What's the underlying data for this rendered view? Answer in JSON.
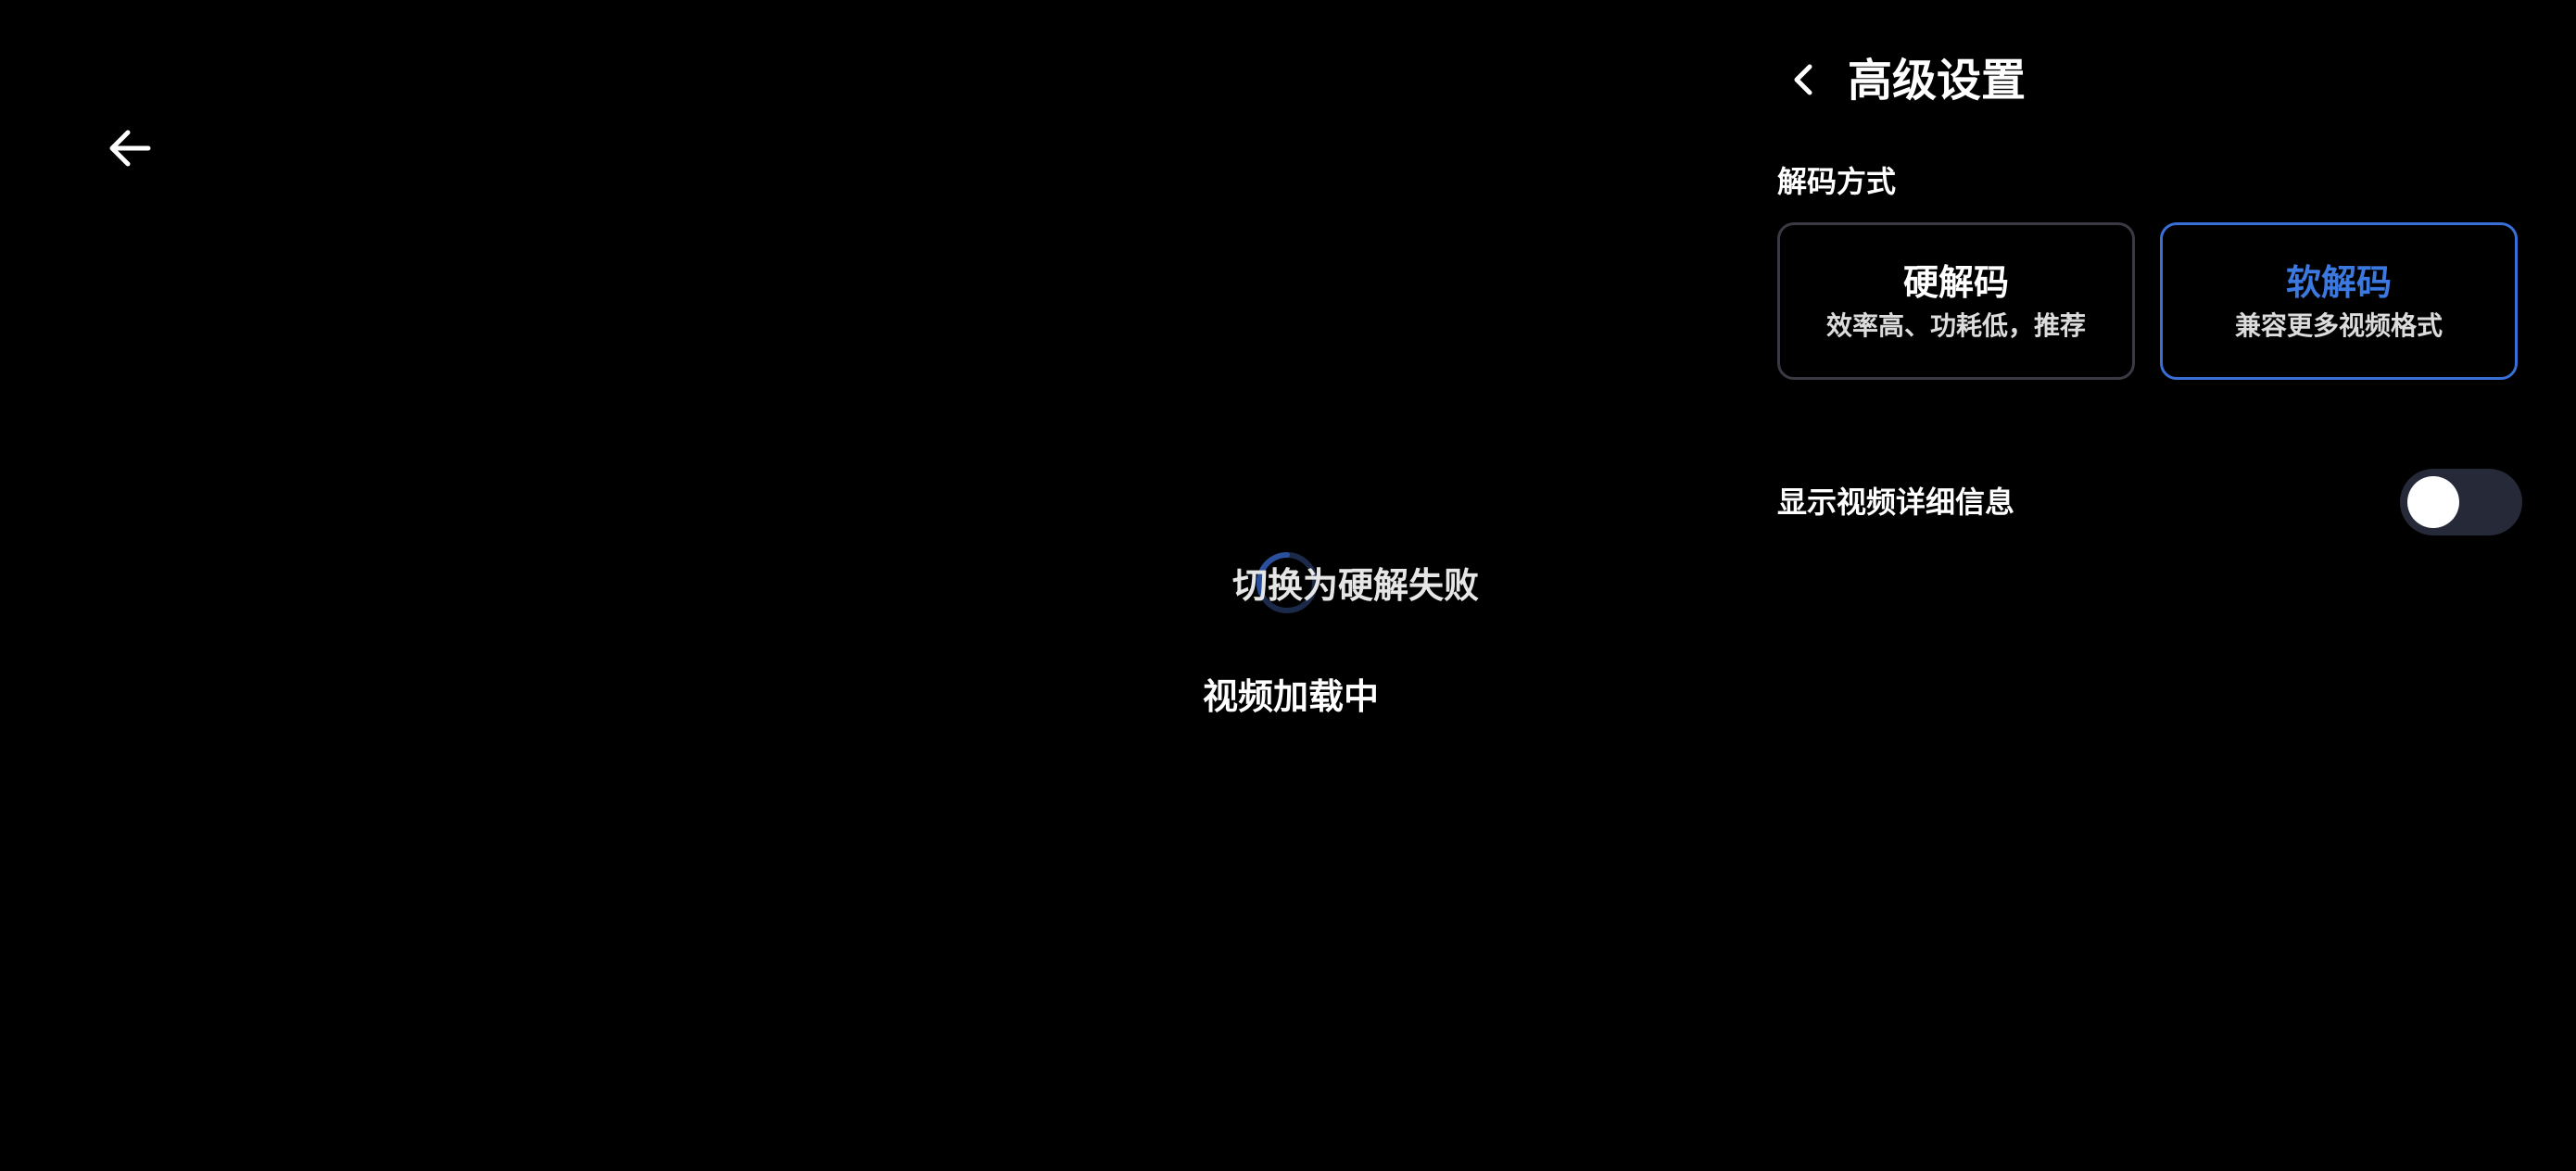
{
  "player": {
    "back_icon": "arrow-left-icon",
    "toast_text": "切换为硬解失败",
    "loading_text": "视频加载中",
    "spinner_icon": "loading-spinner-icon"
  },
  "settings_panel": {
    "back_icon": "chevron-left-icon",
    "title": "高级设置",
    "decode_section_label": "解码方式",
    "options": [
      {
        "title": "硬解码",
        "subtitle": "效率高、功耗低，推荐",
        "selected": false
      },
      {
        "title": "软解码",
        "subtitle": "兼容更多视频格式",
        "selected": true
      }
    ],
    "show_details_label": "显示视频详细信息",
    "show_details_enabled": false
  },
  "colors": {
    "background": "#000000",
    "accent": "#3b78e0",
    "selected_border": "#3b6fd8",
    "card_border": "#3a3a44",
    "toggle_track": "#262a38"
  }
}
